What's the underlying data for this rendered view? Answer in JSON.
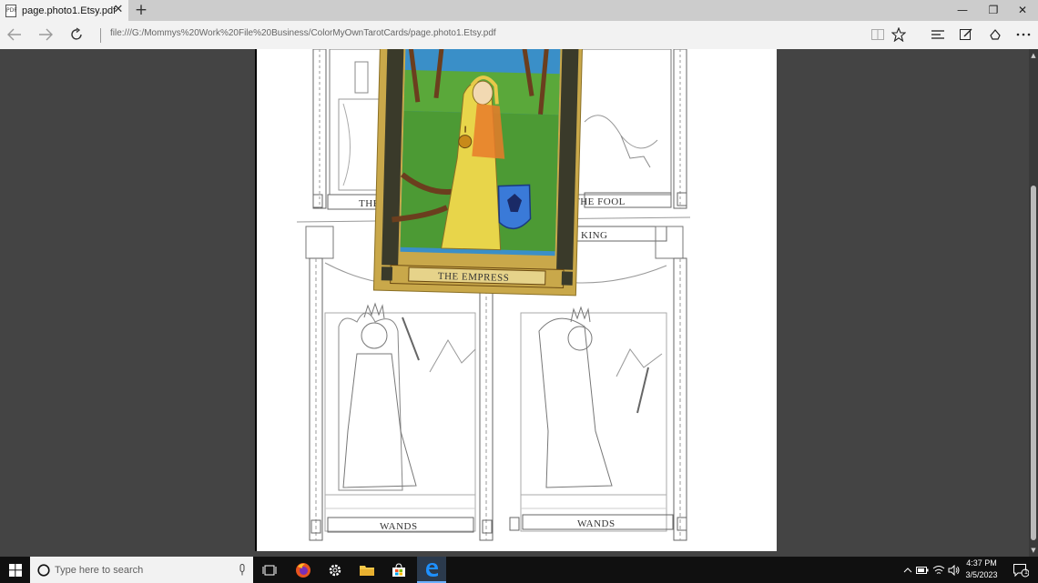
{
  "browser": {
    "tab": {
      "favicon_text": "PDF",
      "title": "page.photo1.Etsy.pdf",
      "close_glyph": "✕"
    },
    "new_tab_glyph": "+",
    "window_controls": {
      "minimize": "—",
      "restore": "❐",
      "close": "✕"
    },
    "address_bar": {
      "url": "file:///G:/Mommys%20Work%20File%20Business/ColorMyOwnTarotCards/page.photo1.Etsy.pdf"
    },
    "icons": [
      "back-icon",
      "forward-icon",
      "refresh-icon",
      "reading-view-icon",
      "favorite-star-icon",
      "hub-icon",
      "web-note-icon",
      "share-icon",
      "more-icon"
    ]
  },
  "document": {
    "cards": [
      {
        "label": "THE"
      },
      {
        "label": "THE FOOL"
      },
      {
        "label": "KING"
      },
      {
        "label": "THE EMPRESS"
      },
      {
        "label": "WANDS"
      },
      {
        "label": "WANDS"
      }
    ]
  },
  "taskbar": {
    "search_placeholder": "Type here to search",
    "time": "4:37 PM",
    "date": "3/5/2023",
    "notification_count": "1",
    "icons": [
      "windows-start-icon",
      "cortana-circle-icon",
      "microphone-icon",
      "task-view-icon",
      "firefox-icon",
      "settings-gear-icon",
      "file-explorer-icon",
      "store-bag-icon",
      "edge-icon",
      "chevron-up-icon",
      "battery-icon",
      "wifi-icon",
      "volume-icon",
      "notification-icon"
    ]
  },
  "colors": {
    "tab_active": "#f2f2f2",
    "titlebar": "#cccccc",
    "viewer_background": "#444444",
    "taskbar": "#101010",
    "card_gold": "#c9a84a",
    "card_sky": "#3a8fc8",
    "card_grass": "#5aa83a",
    "card_gown": "#e8d54a"
  }
}
